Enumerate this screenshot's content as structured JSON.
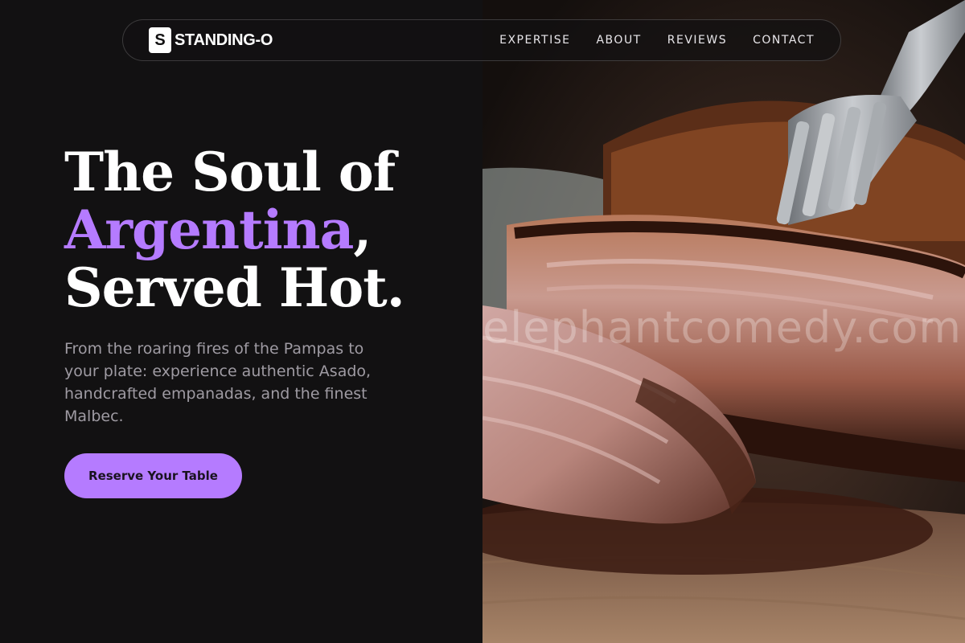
{
  "brand": {
    "mark": "S",
    "name": "STANDING-O"
  },
  "nav": {
    "items": [
      "EXPERTISE",
      "ABOUT",
      "REVIEWS",
      "CONTACT"
    ]
  },
  "hero": {
    "line1": "The Soul of",
    "line2_accent": "Argentina",
    "line2_rest": ",",
    "line3": "Served Hot.",
    "subtitle": "From the roaring fires of the Pampas to your plate: experience authentic Asado, handcrafted empanadas, and the finest Malbec.",
    "cta_label": "Reserve Your Table"
  },
  "image": {
    "subject": "grilled-steak-with-fork",
    "watermark": "elephantcomedy.com"
  },
  "colors": {
    "background": "#121112",
    "accent": "#b57bff",
    "text": "#ffffff",
    "muted": "#9f9ba3"
  }
}
